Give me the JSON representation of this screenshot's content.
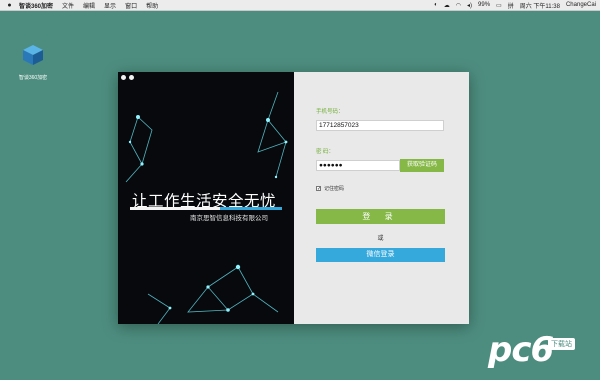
{
  "menubar": {
    "app_name": "智谈360加密",
    "items": [
      "文件",
      "编辑",
      "显示",
      "窗口",
      "帮助"
    ],
    "battery": "99%",
    "datetime": "周六 下午11:38",
    "user": "ChangeCai"
  },
  "desktop": {
    "icon_label": "智谈360加密"
  },
  "brand_panel": {
    "slogan": "让工作生活安全无忧",
    "company": "南京思智信息科技有限公司"
  },
  "login": {
    "phone_label": "手机号码：",
    "phone_value": "17712857023",
    "password_label": "密  码：",
    "password_value": "●●●●●●",
    "sms_button": "获取验证码",
    "remember_label": "记住密码",
    "remember_checked": "✓",
    "login_button": "登 录",
    "or_text": "或",
    "wechat_button": "微信登录"
  },
  "watermark": {
    "text": "pc6",
    "tag": "下载站"
  },
  "colors": {
    "desktop_bg": "#4d8d7f",
    "green_accent": "#86b847",
    "blue_accent": "#35a8dc"
  }
}
